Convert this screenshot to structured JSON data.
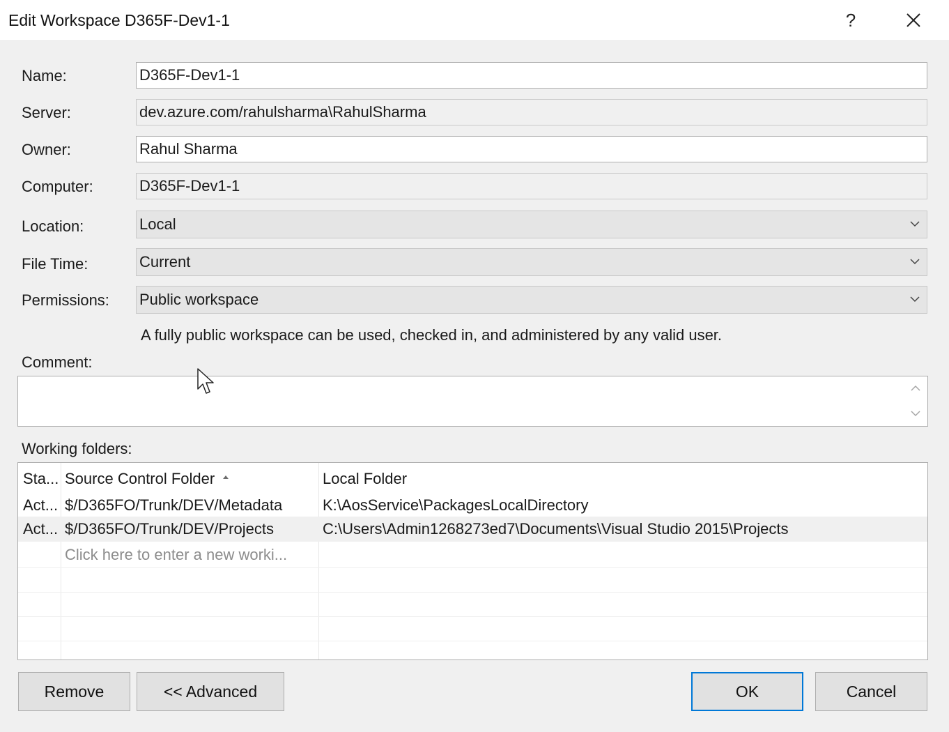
{
  "window": {
    "title": "Edit Workspace D365F-Dev1-1",
    "help_glyph": "?",
    "close_icon": "close-icon"
  },
  "form": {
    "name": {
      "label": "Name:",
      "value": "D365F-Dev1-1"
    },
    "server": {
      "label": "Server:",
      "value": "dev.azure.com/rahulsharma\\RahulSharma"
    },
    "owner": {
      "label": "Owner:",
      "value": "Rahul Sharma"
    },
    "computer": {
      "label": "Computer:",
      "value": "D365F-Dev1-1"
    },
    "location": {
      "label": "Location:",
      "value": "Local"
    },
    "file_time": {
      "label": "File Time:",
      "value": "Current"
    },
    "permissions": {
      "label": "Permissions:",
      "value": "Public workspace"
    },
    "permissions_hint": "A fully public workspace can be used, checked in, and administered by any valid user.",
    "comment": {
      "label": "Comment:",
      "value": ""
    }
  },
  "working_folders": {
    "label": "Working folders:",
    "columns": [
      "Sta...",
      "Source Control Folder",
      "Local Folder"
    ],
    "sort_column": "Source Control Folder",
    "rows": [
      {
        "status": "Act...",
        "source": "$/D365FO/Trunk/DEV/Metadata",
        "local": "K:\\AosService\\PackagesLocalDirectory",
        "selected": false
      },
      {
        "status": "Act...",
        "source": "$/D365FO/Trunk/DEV/Projects",
        "local": "C:\\Users\\Admin1268273ed7\\Documents\\Visual Studio 2015\\Projects",
        "selected": true
      }
    ],
    "new_row_placeholder": "Click here to enter a new worki..."
  },
  "buttons": {
    "remove": "Remove",
    "advanced": "<< Advanced",
    "ok": "OK",
    "cancel": "Cancel"
  },
  "colors": {
    "dialog_bg": "#f0f0f0",
    "selected_row": "#f0f0f0",
    "accent": "#0078d7"
  }
}
